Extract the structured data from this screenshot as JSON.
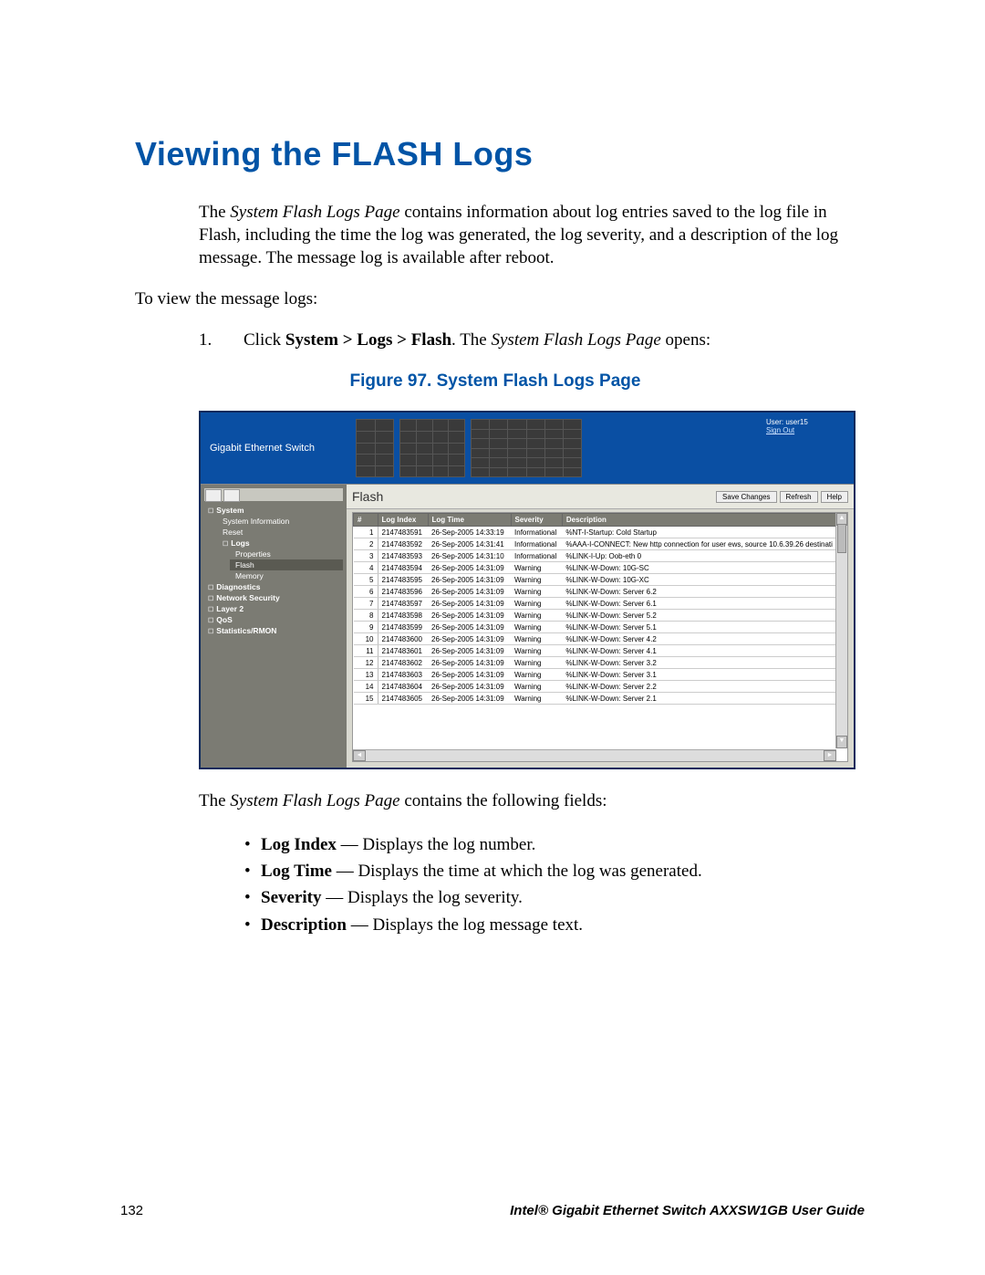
{
  "title": "Viewing the FLASH Logs",
  "intro_before_italic": "The ",
  "intro_italic": "System Flash Logs Page",
  "intro_after_italic": " contains information about log entries saved to the log file in Flash, including the time the log was generated, the log severity, and a description of the log message. The message log is available after reboot.",
  "to_view": "To view the message logs:",
  "step_num": "1.",
  "step_a": "Click ",
  "step_b_bold": "System > Logs > Flash",
  "step_c": ". The ",
  "step_d_italic": "System Flash Logs Page",
  "step_e": " opens:",
  "fig_caption": "Figure 97. System Flash Logs Page",
  "embed": {
    "brand": "Gigabit Ethernet Switch",
    "user_label": "User: user15",
    "signout": "Sign Out",
    "panel_title": "Flash",
    "buttons": {
      "save": "Save Changes",
      "refresh": "Refresh",
      "help": "Help"
    },
    "nav": [
      {
        "label": "System",
        "cls": "top"
      },
      {
        "label": "System Information",
        "cls": "sub"
      },
      {
        "label": "Reset",
        "cls": "sub"
      },
      {
        "label": "Logs",
        "cls": "sub top"
      },
      {
        "label": "Properties",
        "cls": "sub2"
      },
      {
        "label": "Flash",
        "cls": "sub2 sel"
      },
      {
        "label": "Memory",
        "cls": "sub2"
      },
      {
        "label": "Diagnostics",
        "cls": "top"
      },
      {
        "label": "Network Security",
        "cls": "top"
      },
      {
        "label": "Layer 2",
        "cls": "top"
      },
      {
        "label": "QoS",
        "cls": "top"
      },
      {
        "label": "Statistics/RMON",
        "cls": "top"
      }
    ],
    "headers": {
      "n": "#",
      "idx": "Log Index",
      "time": "Log Time",
      "sev": "Severity",
      "desc": "Description"
    },
    "rows": [
      {
        "n": "1",
        "idx": "2147483591",
        "time": "26-Sep-2005 14:33:19",
        "sev": "Informational",
        "desc": "%NT-I-Startup: Cold Startup"
      },
      {
        "n": "2",
        "idx": "2147483592",
        "time": "26-Sep-2005 14:31:41",
        "sev": "Informational",
        "desc": "%AAA-I-CONNECT: New http connection for user ews, source 10.6.39.26 destinati"
      },
      {
        "n": "3",
        "idx": "2147483593",
        "time": "26-Sep-2005 14:31:10",
        "sev": "Informational",
        "desc": "%LINK-I-Up: Oob-eth 0"
      },
      {
        "n": "4",
        "idx": "2147483594",
        "time": "26-Sep-2005 14:31:09",
        "sev": "Warning",
        "desc": "%LINK-W-Down: 10G-SC"
      },
      {
        "n": "5",
        "idx": "2147483595",
        "time": "26-Sep-2005 14:31:09",
        "sev": "Warning",
        "desc": "%LINK-W-Down: 10G-XC"
      },
      {
        "n": "6",
        "idx": "2147483596",
        "time": "26-Sep-2005 14:31:09",
        "sev": "Warning",
        "desc": "%LINK-W-Down: Server 6.2"
      },
      {
        "n": "7",
        "idx": "2147483597",
        "time": "26-Sep-2005 14:31:09",
        "sev": "Warning",
        "desc": "%LINK-W-Down: Server 6.1"
      },
      {
        "n": "8",
        "idx": "2147483598",
        "time": "26-Sep-2005 14:31:09",
        "sev": "Warning",
        "desc": "%LINK-W-Down: Server 5.2"
      },
      {
        "n": "9",
        "idx": "2147483599",
        "time": "26-Sep-2005 14:31:09",
        "sev": "Warning",
        "desc": "%LINK-W-Down: Server 5.1"
      },
      {
        "n": "10",
        "idx": "2147483600",
        "time": "26-Sep-2005 14:31:09",
        "sev": "Warning",
        "desc": "%LINK-W-Down: Server 4.2"
      },
      {
        "n": "11",
        "idx": "2147483601",
        "time": "26-Sep-2005 14:31:09",
        "sev": "Warning",
        "desc": "%LINK-W-Down: Server 4.1"
      },
      {
        "n": "12",
        "idx": "2147483602",
        "time": "26-Sep-2005 14:31:09",
        "sev": "Warning",
        "desc": "%LINK-W-Down: Server 3.2"
      },
      {
        "n": "13",
        "idx": "2147483603",
        "time": "26-Sep-2005 14:31:09",
        "sev": "Warning",
        "desc": "%LINK-W-Down: Server 3.1"
      },
      {
        "n": "14",
        "idx": "2147483604",
        "time": "26-Sep-2005 14:31:09",
        "sev": "Warning",
        "desc": "%LINK-W-Down: Server 2.2"
      },
      {
        "n": "15",
        "idx": "2147483605",
        "time": "26-Sep-2005 14:31:09",
        "sev": "Warning",
        "desc": "%LINK-W-Down: Server 2.1"
      }
    ]
  },
  "after_fig_a": "The ",
  "after_fig_b_italic": "System Flash Logs Page",
  "after_fig_c": " contains the following fields:",
  "fields": [
    {
      "b": "Log Index",
      "t": " — Displays the log number."
    },
    {
      "b": "Log Time",
      "t": " — Displays the time at which the log was generated."
    },
    {
      "b": "Severity",
      "t": " — Displays the log severity."
    },
    {
      "b": "Description",
      "t": " — Displays the log message text."
    }
  ],
  "footer": {
    "page": "132",
    "guide": "Intel® Gigabit Ethernet Switch AXXSW1GB User Guide"
  }
}
